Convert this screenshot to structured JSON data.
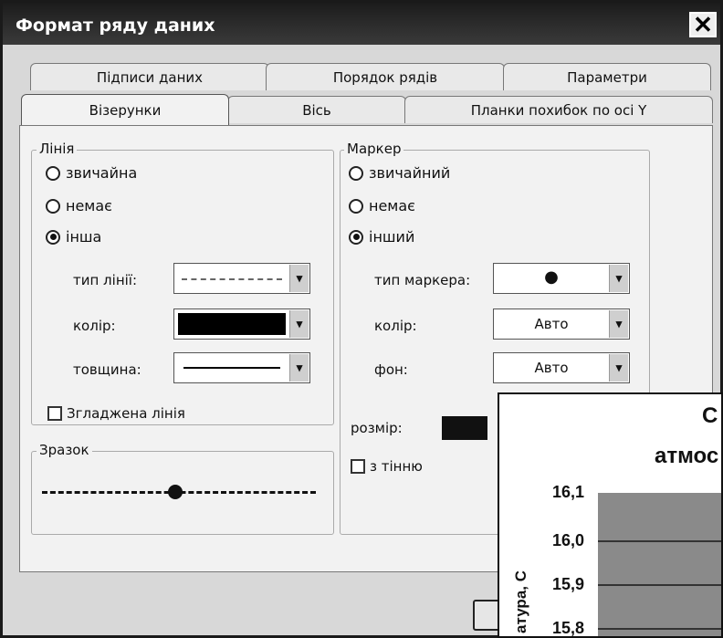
{
  "dialog": {
    "title": "Формат ряду даних",
    "close_glyph": "✕"
  },
  "tabs_back": [
    "Підписи даних",
    "Порядок рядів",
    "Параметри"
  ],
  "tabs_front": [
    "Візерунки",
    "Вісь",
    "Планки похибок по осі Y"
  ],
  "active_tab": "Візерунки",
  "line_group": {
    "label": "Лінія",
    "options": [
      "звичайна",
      "немає",
      "інша"
    ],
    "selected": "інша",
    "type_label": "тип лінії:",
    "color_label": "колір:",
    "color_value": "#000000",
    "thickness_label": "товщина:",
    "smooth_label": "Згладжена лінія",
    "smooth_checked": false
  },
  "sample": {
    "label": "Зразок"
  },
  "marker_group": {
    "label": "Маркер",
    "options": [
      "звичайний",
      "немає",
      "інший"
    ],
    "selected": "інший",
    "type_label": "тип маркера:",
    "type_value": "●",
    "color_label": "колір:",
    "color_value": "Авто",
    "bg_label": "фон:",
    "bg_value": "Авто",
    "size_label": "розмір:",
    "shadow_label": "з тінню",
    "shadow_checked": false
  },
  "chart_overlay": {
    "title_line1": "С",
    "title_line2": "атмос",
    "ylabel": "атура, С",
    "ticks": [
      "16,1",
      "16,0",
      "15,9",
      "15,8"
    ]
  },
  "icons": {
    "arrow": "▾"
  }
}
